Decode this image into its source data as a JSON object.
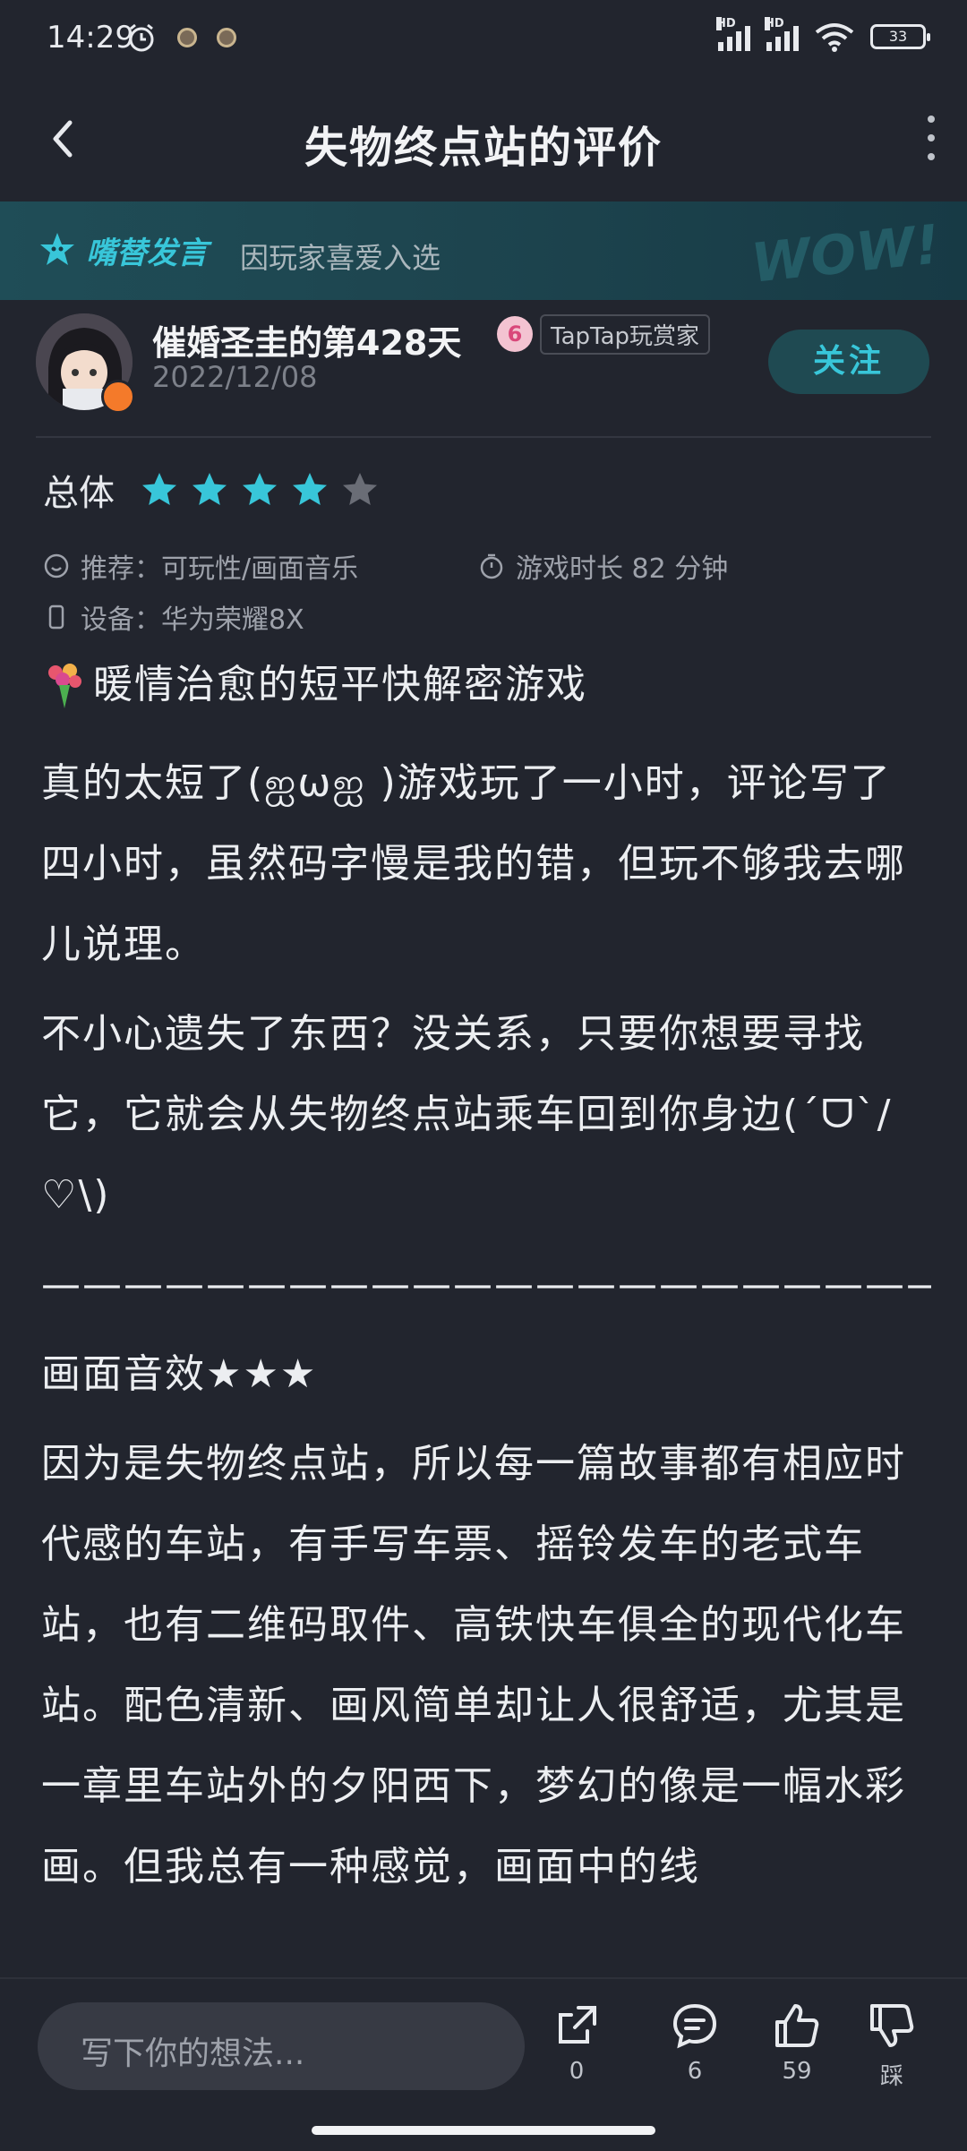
{
  "status_bar": {
    "time": "14:29",
    "battery": "33",
    "network_label": "HD"
  },
  "header": {
    "title": "失物终点站的评价"
  },
  "banner": {
    "brand": "嘴替发言",
    "text": "因玩家喜爱入选",
    "decoration": "WOW!"
  },
  "user": {
    "name": "催婚圣圭的第428天",
    "date": "2022/12/08",
    "badge_level": "6",
    "badge_label": "TapTap玩赏家",
    "follow_label": "关注"
  },
  "rating": {
    "label": "总体",
    "score": 4,
    "max": 5,
    "colors": {
      "filled": "#38c6d9",
      "empty": "#6a6d76"
    }
  },
  "meta": {
    "recommend": "推荐：可玩性/画面音乐",
    "playtime": "游戏时长 82 分钟",
    "device": "设备：华为荣耀8X"
  },
  "review": {
    "headline": "暖情治愈的短平快解密游戏",
    "paragraphs": [
      "真的太短了(ஐωஐ )游戏玩了一小时，评论写了四小时，虽然码字慢是我的错，但玩不够我去哪儿说理。",
      "不小心遗失了东西？没关系，只要你想要寻找它，它就会从失物终点站乘车回到你身边(´ᗜ`/♡\\)",
      "——————————————————————",
      "画面音效★★★",
      "因为是失物终点站，所以每一篇故事都有相应时代感的车站，有手写车票、摇铃发车的老式车站，也有二维码取件、高铁快车俱全的现代化车站。配色清新、画风简单却让人很舒适，尤其是一章里车站外的夕阳西下，梦幻的像是一幅水彩画。但我总有一种感觉，画面中的线"
    ]
  },
  "bottom_bar": {
    "input_placeholder": "写下你的想法...",
    "share_count": "0",
    "comment_count": "6",
    "like_count": "59",
    "dislike_label": "踩"
  },
  "accent_color": "#38c6d9"
}
